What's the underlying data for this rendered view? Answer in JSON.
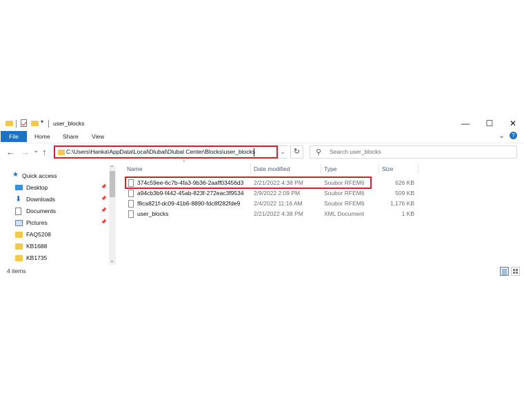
{
  "window": {
    "title": "user_blocks",
    "controls": {
      "minimize": "—",
      "maximize": "☐",
      "close": "✕"
    }
  },
  "ribbon": {
    "tabs": [
      "File",
      "Home",
      "Share",
      "View"
    ],
    "expand": "⌄",
    "help": "?"
  },
  "navigation": {
    "back": "←",
    "forward": "→",
    "recent": "⌄",
    "up": "↑"
  },
  "address": {
    "path": "C:\\Users\\Hanka\\AppData\\Local\\Dlubal\\Dlubal Center\\Blocks\\user_blocks"
  },
  "search": {
    "placeholder": "Search user_blocks"
  },
  "nav_pane": {
    "items": [
      {
        "label": "Quick access",
        "icon": "star-icon"
      },
      {
        "label": "Desktop",
        "icon": "desktop-icon",
        "pinned": true
      },
      {
        "label": "Downloads",
        "icon": "download-icon",
        "pinned": true
      },
      {
        "label": "Documents",
        "icon": "documents-icon",
        "pinned": true
      },
      {
        "label": "Pictures",
        "icon": "pictures-icon",
        "pinned": true
      },
      {
        "label": "FAQ5208",
        "icon": "folder-icon"
      },
      {
        "label": "KB1688",
        "icon": "folder-icon"
      },
      {
        "label": "KB1735",
        "icon": "folder-icon"
      }
    ]
  },
  "file_list": {
    "sort_indicator": "^",
    "columns": {
      "name": "Name",
      "date": "Date modified",
      "type": "Type",
      "size": "Size"
    },
    "rows": [
      {
        "name": "374c59ee-6c7b-4fa3-9b36-2aaff03456d3",
        "date": "2/21/2022 4:38 PM",
        "type": "Soubor RFEM6",
        "size": "626 KB"
      },
      {
        "name": "a94cb3b9-f442-45ab-823f-272eac3f9534",
        "date": "2/9/2022 2:09 PM",
        "type": "Soubor RFEM6",
        "size": "509 KB"
      },
      {
        "name": "f8ca821f-dc09-41b6-8890-fdc8f282fde9",
        "date": "2/4/2022 11:16 AM",
        "type": "Soubor RFEM6",
        "size": "1,176 KB"
      },
      {
        "name": "user_blocks",
        "date": "2/21/2022 4:38 PM",
        "type": "XML Document",
        "size": "1 KB"
      }
    ]
  },
  "status": {
    "item_count": "4 items"
  },
  "colors": {
    "accent": "#1a73c8",
    "highlight": "#d0202a",
    "folder": "#f2c94c"
  }
}
